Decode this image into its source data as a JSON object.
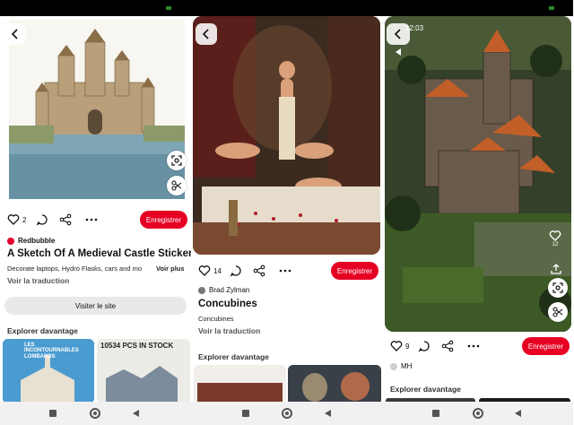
{
  "screen1": {
    "save_label": "Enregistrer",
    "like_count": "2",
    "source": "Redbubble",
    "title": "A Sketch Of A Medieval Castle Sticker",
    "description": "Decorate laptops, Hydro Flasks, cars and mo",
    "see_more": "Voir plus",
    "translate": "Voir la traduction",
    "visit": "Visiter le site",
    "explore": "Explorer davantage",
    "thumb1_text": "LES INCONTOURNABLES LOMBARDS",
    "thumb2_text": "10534 PCS IN STOCK"
  },
  "screen2": {
    "save_label": "Enregistrer",
    "like_count": "14",
    "author": "Brad Zylman",
    "title": "Concubines",
    "subtitle": "Concubines",
    "translate": "Voir la traduction",
    "explore": "Explorer davantage"
  },
  "screen3": {
    "time": "12:03",
    "save_label": "Enregistrer",
    "like_count": "9",
    "side_count": "12",
    "author": "MH",
    "explore": "Explorer davantage"
  },
  "colors": {
    "brand_red": "#e60023",
    "status_bar": "#000000",
    "nav_bar": "#f1f1f1"
  },
  "icons": [
    "chevron-left-icon",
    "heart-icon",
    "comment-icon",
    "share-icon",
    "more-icon",
    "lens-icon",
    "scissors-icon",
    "upload-icon"
  ]
}
